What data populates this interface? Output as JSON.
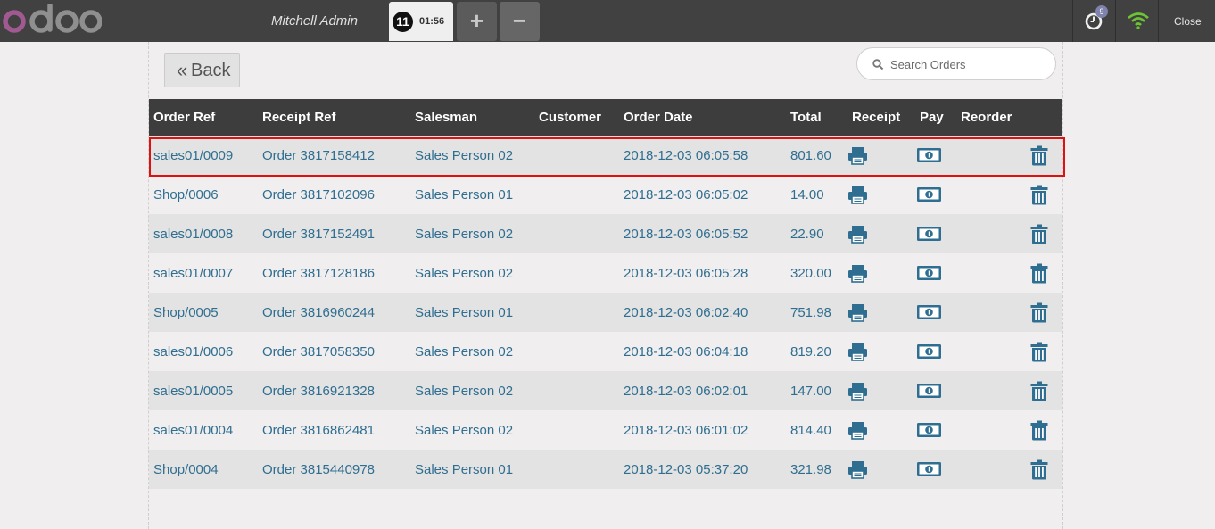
{
  "header": {
    "logo_text": "odoo",
    "cashier": "Mitchell Admin",
    "active_order": {
      "number": "11",
      "time": "01:56"
    },
    "add_order_icon": "plus-icon",
    "remove_order_icon": "minus-icon",
    "sync_badge": "9",
    "close_label": "Close",
    "colors": {
      "bar": "#414141",
      "logo_o": "#a05a91",
      "wifi": "#6cc435"
    }
  },
  "toolbar": {
    "back_label": "Back",
    "search_placeholder": "Search Orders"
  },
  "table": {
    "columns": [
      "Order Ref",
      "Receipt Ref",
      "Salesman",
      "Customer",
      "Order Date",
      "Total",
      "Receipt",
      "Pay",
      "Reorder"
    ],
    "rows": [
      {
        "order_ref": "sales01/0009",
        "receipt_ref": "Order 3817158412",
        "salesman": "Sales Person 02",
        "customer": "",
        "date": "2018-12-03 06:05:58",
        "total": "801.60"
      },
      {
        "order_ref": "Shop/0006",
        "receipt_ref": "Order 3817102096",
        "salesman": "Sales Person 01",
        "customer": "",
        "date": "2018-12-03 06:05:02",
        "total": "14.00"
      },
      {
        "order_ref": "sales01/0008",
        "receipt_ref": "Order 3817152491",
        "salesman": "Sales Person 02",
        "customer": "",
        "date": "2018-12-03 06:05:52",
        "total": "22.90"
      },
      {
        "order_ref": "sales01/0007",
        "receipt_ref": "Order 3817128186",
        "salesman": "Sales Person 02",
        "customer": "",
        "date": "2018-12-03 06:05:28",
        "total": "320.00"
      },
      {
        "order_ref": "Shop/0005",
        "receipt_ref": "Order 3816960244",
        "salesman": "Sales Person 01",
        "customer": "",
        "date": "2018-12-03 06:02:40",
        "total": "751.98"
      },
      {
        "order_ref": "sales01/0006",
        "receipt_ref": "Order 3817058350",
        "salesman": "Sales Person 02",
        "customer": "",
        "date": "2018-12-03 06:04:18",
        "total": "819.20"
      },
      {
        "order_ref": "sales01/0005",
        "receipt_ref": "Order 3816921328",
        "salesman": "Sales Person 02",
        "customer": "",
        "date": "2018-12-03 06:02:01",
        "total": "147.00"
      },
      {
        "order_ref": "sales01/0004",
        "receipt_ref": "Order 3816862481",
        "salesman": "Sales Person 02",
        "customer": "",
        "date": "2018-12-03 06:01:02",
        "total": "814.40"
      },
      {
        "order_ref": "Shop/0004",
        "receipt_ref": "Order 3815440978",
        "salesman": "Sales Person 01",
        "customer": "",
        "date": "2018-12-03 05:37:20",
        "total": "321.98"
      }
    ],
    "highlighted_row": 0,
    "row_icons": {
      "receipt": "print-icon",
      "pay": "money-icon",
      "reorder": "trash-icon"
    },
    "link_color": "#2f6e90",
    "highlight_color": "#e01010"
  }
}
